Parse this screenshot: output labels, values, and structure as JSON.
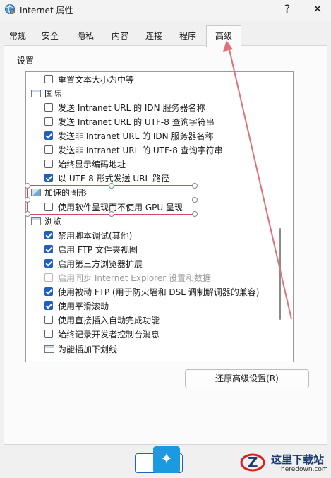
{
  "window": {
    "title": "Internet 属性",
    "help": "?",
    "close": "✕"
  },
  "tabs": [
    {
      "label": "常规",
      "active": false
    },
    {
      "label": "安全",
      "active": false
    },
    {
      "label": "隐私",
      "active": false
    },
    {
      "label": "内容",
      "active": false
    },
    {
      "label": "连接",
      "active": false
    },
    {
      "label": "程序",
      "active": false
    },
    {
      "label": "高级",
      "active": true
    }
  ],
  "settings": {
    "group_label": "设置",
    "items": [
      {
        "type": "checkbox",
        "label": "重置文本大小为中等",
        "checked": false,
        "disabled": false
      },
      {
        "type": "category",
        "label": "国际",
        "icon": "settings-category-icon"
      },
      {
        "type": "checkbox",
        "label": "发送 Intranet URL 的 IDN 服务器名称",
        "checked": false,
        "disabled": false
      },
      {
        "type": "checkbox",
        "label": "发送 Intranet URL 的 UTF-8 查询字符串",
        "checked": false,
        "disabled": false
      },
      {
        "type": "checkbox",
        "label": "发送非 Intranet URL 的 IDN 服务器名称",
        "checked": true,
        "disabled": false
      },
      {
        "type": "checkbox",
        "label": "发送非 Intranet URL 的 UTF-8 查询字符串",
        "checked": false,
        "disabled": false
      },
      {
        "type": "checkbox",
        "label": "始终显示编码地址",
        "checked": false,
        "disabled": false
      },
      {
        "type": "checkbox",
        "label": "以 UTF-8 形式发送 URL 路径",
        "checked": true,
        "disabled": false
      },
      {
        "type": "category",
        "label": "加速的图形",
        "icon": "graphics-category-icon"
      },
      {
        "type": "checkbox",
        "label": "使用软件呈现而不使用 GPU 呈现",
        "checked": false,
        "disabled": false
      },
      {
        "type": "category",
        "label": "浏览",
        "icon": "settings-category-icon"
      },
      {
        "type": "checkbox",
        "label": "禁用脚本调试(其他)",
        "checked": true,
        "disabled": false
      },
      {
        "type": "checkbox",
        "label": "启用 FTP 文件夹视图",
        "checked": true,
        "disabled": false
      },
      {
        "type": "checkbox",
        "label": "启用第三方浏览器扩展",
        "checked": true,
        "disabled": false
      },
      {
        "type": "checkbox",
        "label": "启用同步 Internet Explorer 设置和数据",
        "checked": false,
        "disabled": true
      },
      {
        "type": "checkbox",
        "label": "使用被动 FTP (用于防火墙和 DSL 调制解调器的兼容)",
        "checked": true,
        "disabled": false
      },
      {
        "type": "checkbox",
        "label": "使用平滑滚动",
        "checked": true,
        "disabled": false
      },
      {
        "type": "checkbox",
        "label": "使用直接插入自动完成功能",
        "checked": false,
        "disabled": false
      },
      {
        "type": "checkbox",
        "label": "始终记录开发者控制台消息",
        "checked": false,
        "disabled": false
      },
      {
        "type": "category",
        "label": "为能插加下划线",
        "icon": "settings-category-icon"
      }
    ],
    "restore_button": "还原高级设置(R)"
  },
  "watermark": {
    "title": "这里下载站",
    "url": "heredown.com"
  },
  "colors": {
    "accent": "#1f5fbf",
    "annotation": "#d24d57"
  }
}
